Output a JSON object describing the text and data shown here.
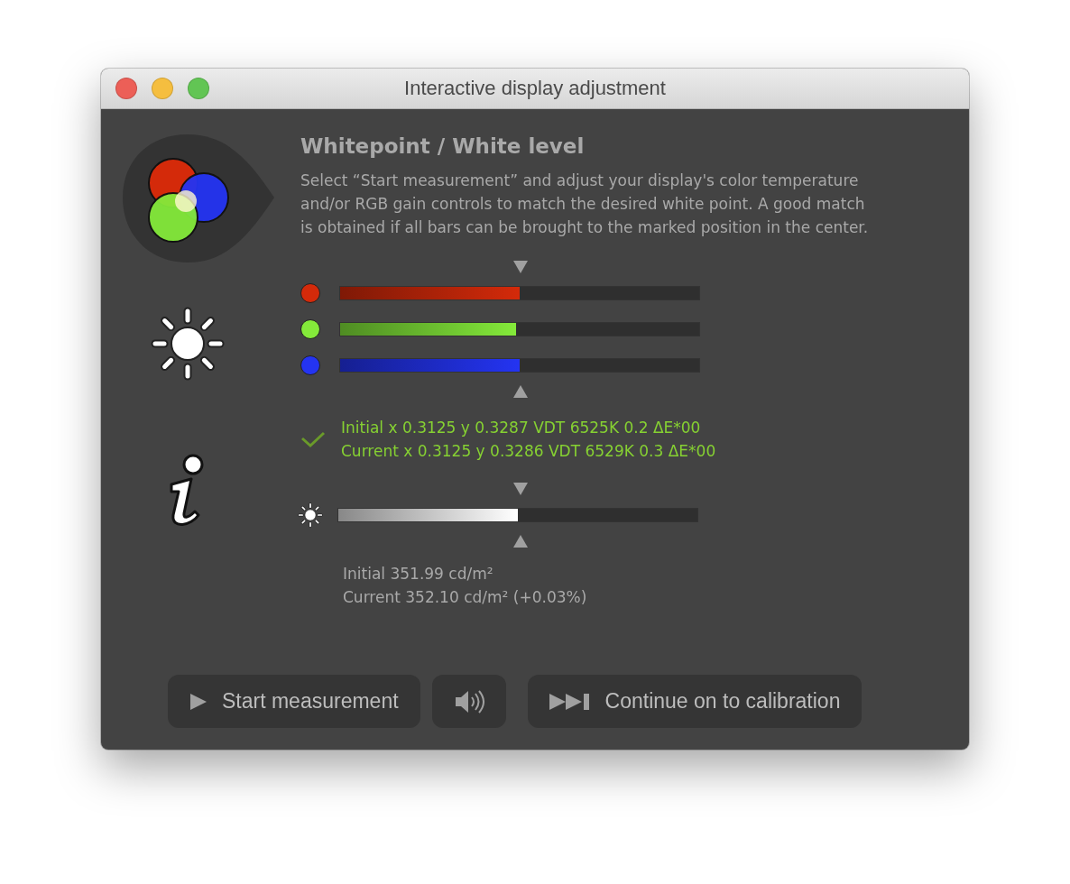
{
  "window": {
    "title": "Interactive display adjustment"
  },
  "heading": "Whitepoint / White level",
  "description": "Select “Start measurement” and adjust your display's color temperature and/or RGB gain controls to match the desired white point. A good match is obtained if all bars can be brought to the marked position in the center.",
  "channels": [
    {
      "color": "#d42a0a",
      "level": 0.5
    },
    {
      "color": "#84ea3a",
      "level": 0.49
    },
    {
      "color": "#2434f2",
      "level": 0.5
    }
  ],
  "measurement": {
    "matched": true,
    "lines": [
      "Initial x 0.3125 y 0.3287 VDT 6525K 0.2 ΔE*00",
      "Current x 0.3125 y 0.3286 VDT 6529K 0.3 ΔE*00"
    ]
  },
  "luminance": {
    "level": 0.5,
    "lines": [
      "Initial 351.99 cd/m²",
      "Current 352.10 cd/m² (+0.03%)"
    ]
  },
  "buttons": [
    {
      "kind": "play",
      "label": "Start measurement"
    },
    {
      "kind": "sound"
    },
    {
      "kind": "skip",
      "label": "Continue on to calibration"
    }
  ]
}
